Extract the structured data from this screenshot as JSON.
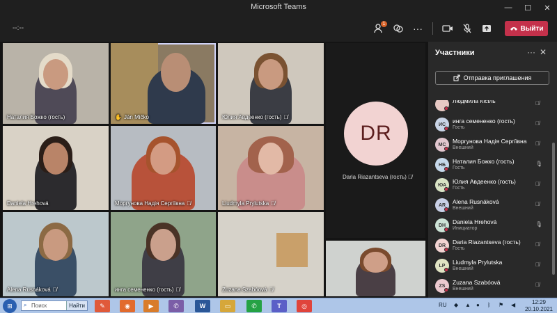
{
  "window": {
    "title": "Microsoft Teams",
    "minimize": "—",
    "maximize": "☐",
    "close": "✕"
  },
  "toolbar": {
    "timer": "--:--",
    "participants_badge": "1",
    "leave_label": "Выйти"
  },
  "tiles": [
    {
      "name": "Наталия Божко (гость)",
      "mic_muted": false
    },
    {
      "name": "Ján Mičko",
      "hand_raised": true,
      "mic_muted": false
    },
    {
      "name": "Юлия Авдеенко (гость)",
      "mic_muted": true
    },
    {
      "name": "Daniela Hrehová",
      "mic_muted": false
    },
    {
      "name": "Моргунова Надія Сергіївна",
      "mic_muted": true
    },
    {
      "name": "Liudmyla Prylutska",
      "mic_muted": true
    },
    {
      "name": "Alena Rusnáková",
      "mic_muted": true
    },
    {
      "name": "инга семененко (гость)",
      "mic_muted": true
    },
    {
      "name": "Zuzana Szabóová",
      "mic_muted": true
    }
  ],
  "avatar_tile": {
    "initials": "DR",
    "name": "Daria Riazantseva (гость)"
  },
  "panel": {
    "title": "Участники",
    "invite_label": "Отправка приглашения",
    "participants": [
      {
        "initials": "",
        "name": "Людмила Кісіль",
        "role": "",
        "status": "#c4314b",
        "color": "#e7c9c4",
        "mic": "off"
      },
      {
        "initials": "ИС",
        "name": "инга семененко (гость)",
        "role": "Гость",
        "status": "#c4314b",
        "color": "#c9d4e6",
        "mic": "off"
      },
      {
        "initials": "МС",
        "name": "Моргунова Надія Сергіївна",
        "role": "Внешний",
        "status": "#c4314b",
        "color": "#e2c7cf",
        "mic": "off"
      },
      {
        "initials": "НБ",
        "name": "Наталия Божко (гость)",
        "role": "Гость",
        "status": "#c4314b",
        "color": "#c6d8ea",
        "mic": "on"
      },
      {
        "initials": "ЮА",
        "name": "Юлия Авдеенко (гость)",
        "role": "Гость",
        "status": "#c4314b",
        "color": "#d9e3c5",
        "mic": "off"
      },
      {
        "initials": "AR",
        "name": "Alena Rusnáková",
        "role": "Внешний",
        "status": "#c4314b",
        "color": "#c9d0e6",
        "mic": "off"
      },
      {
        "initials": "DH",
        "name": "Daniela Hrehová",
        "role": "Инициатор",
        "status": "#c4314b",
        "color": "#cde3d6",
        "mic": "on"
      },
      {
        "initials": "DR",
        "name": "Daria Riazantseva (гость)",
        "role": "Гость",
        "status": "#c4314b",
        "color": "#f2d3d2",
        "mic": "off"
      },
      {
        "initials": "LP",
        "name": "Liudmyla Prylutska",
        "role": "Внешний",
        "status": "#c4314b",
        "color": "#e0e3c3",
        "mic": "off"
      },
      {
        "initials": "ZS",
        "name": "Zuzana Szabóová",
        "role": "Внешний",
        "status": "#c4314b",
        "color": "#ecc9cf",
        "mic": "off"
      }
    ]
  },
  "taskbar": {
    "search_placeholder": "Поиск",
    "search_button": "Найти",
    "lang": "RU",
    "time": "12:29",
    "date": "20.10.2021"
  }
}
